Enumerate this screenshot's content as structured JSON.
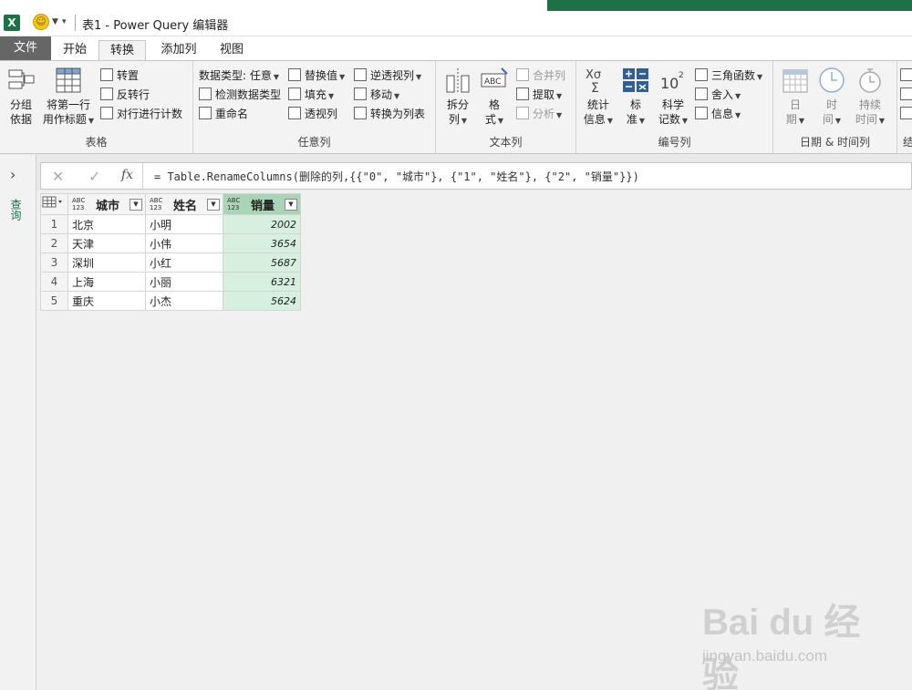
{
  "titlebar": {
    "app_badge": "X",
    "smiley": "☺",
    "title": "表1 - Power Query 编辑器"
  },
  "tabs": [
    {
      "label": "文件"
    },
    {
      "label": "开始"
    },
    {
      "label": "转换"
    },
    {
      "label": "添加列"
    },
    {
      "label": "视图"
    }
  ],
  "active_tab": "转换",
  "ribbon": {
    "table_group": {
      "label": "表格",
      "group_by_line1": "分组",
      "group_by_line2": "依据",
      "first_row_line1": "将第一行",
      "first_row_line2": "用作标题",
      "transpose": "转置",
      "reverse_rows": "反转行",
      "count_rows": "对行进行计数"
    },
    "any_column_group": {
      "label": "任意列",
      "data_type": "数据类型: 任意",
      "detect_type": "检测数据类型",
      "rename": "重命名",
      "replace_values": "替换值",
      "fill": "填充",
      "pivot": "透视列",
      "unpivot": "逆透视列",
      "move": "移动",
      "to_list": "转换为列表"
    },
    "text_column_group": {
      "label": "文本列",
      "split_line1": "拆分",
      "split_line2": "列",
      "format_line1": "格",
      "format_line2": "式",
      "merge": "合并列",
      "extract": "提取",
      "parse": "分析"
    },
    "number_column_group": {
      "label": "编号列",
      "stats_line1": "统计",
      "stats_line2": "信息",
      "standard_line1": "标",
      "standard_line2": "准",
      "scientific_line1": "科学",
      "scientific_line2": "记数",
      "trig": "三角函数",
      "rounding": "舍入",
      "info": "信息"
    },
    "datetime_group": {
      "label": "日期 & 时间列",
      "date_line1": "日",
      "date_line2": "期",
      "time_line1": "时",
      "time_line2": "间",
      "duration_line1": "持续",
      "duration_line2": "时间"
    },
    "partial_group_label": "结"
  },
  "left_pane": {
    "label": "查询"
  },
  "formula_bar": {
    "cancel": "✕",
    "confirm": "✓",
    "fx": "fx",
    "formula": "= Table.RenameColumns(删除的列,{{\"0\", \"城市\"}, {\"1\", \"姓名\"}, {\"2\", \"销量\"}})"
  },
  "grid": {
    "type_badge_top": "ABC",
    "type_badge_bottom": "123",
    "columns": [
      "城市",
      "姓名",
      "销量"
    ],
    "rows": [
      {
        "n": "1",
        "city": "北京",
        "name": "小明",
        "sales": "2002"
      },
      {
        "n": "2",
        "city": "天津",
        "name": "小伟",
        "sales": "3654"
      },
      {
        "n": "3",
        "city": "深圳",
        "name": "小红",
        "sales": "5687"
      },
      {
        "n": "4",
        "city": "上海",
        "name": "小丽",
        "sales": "6321"
      },
      {
        "n": "5",
        "city": "重庆",
        "name": "小杰",
        "sales": "5624"
      }
    ]
  },
  "watermark": {
    "brand": "Bai du 经验",
    "url": "jingyan.baidu.com"
  }
}
